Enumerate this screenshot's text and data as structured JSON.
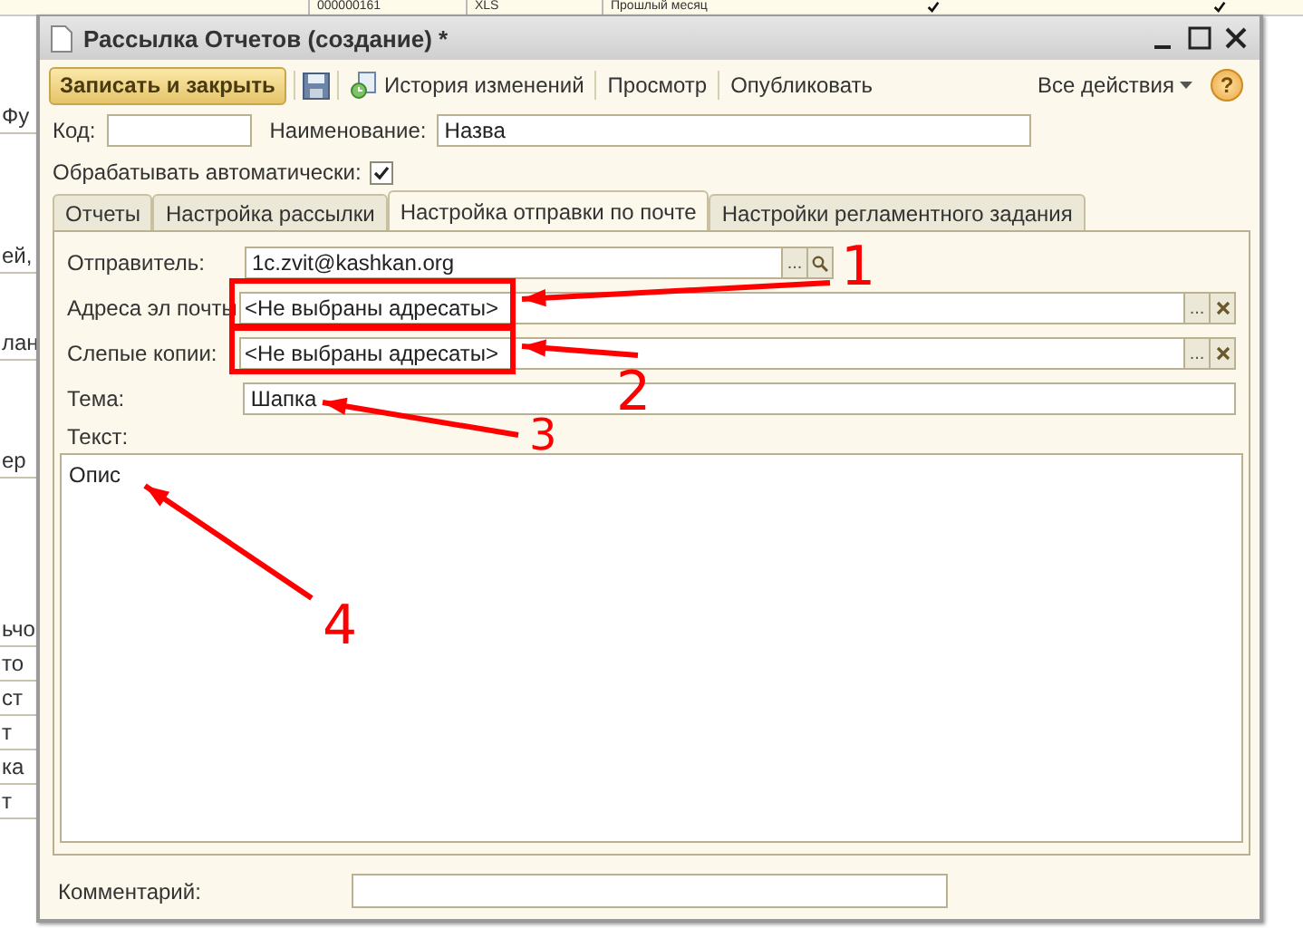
{
  "background_table": {
    "top_row": [
      "000000161",
      "XLS",
      "Прошлый месяц"
    ],
    "top_checks": [
      {
        "checked": true
      },
      {
        "checked": true
      }
    ],
    "left_fragments": [
      "Фу",
      "ей,",
      "лан",
      "ер",
      "ьчо",
      "то",
      "ст",
      "т",
      "ка",
      "т"
    ]
  },
  "window": {
    "title": "Рассылка Отчетов (создание) *"
  },
  "toolbar": {
    "primary_button": "Записать и закрыть",
    "history": "История изменений",
    "preview": "Просмотр",
    "publish": "Опубликовать",
    "all_actions": "Все действия",
    "help": "?"
  },
  "code_field": {
    "label": "Код:"
  },
  "name_field": {
    "label": "Наименование:",
    "value": "Назва"
  },
  "auto_process": {
    "label": "Обрабатывать автоматически:",
    "checked": true
  },
  "tabs": [
    {
      "label": "Отчеты",
      "selected": false
    },
    {
      "label": "Настройка рассылки",
      "selected": false
    },
    {
      "label": "Настройка отправки по почте",
      "selected": true
    },
    {
      "label": "Настройки регламентного задания",
      "selected": false
    }
  ],
  "mail_settings": {
    "sender": {
      "label": "Отправитель:",
      "value": "1c.zvit@kashkan.org",
      "choose": "..."
    },
    "recipients": {
      "label": "Адреса эл почты",
      "placeholder": "<Не выбраны адресаты>",
      "choose": "..."
    },
    "bcc": {
      "label": "Слепые копии:",
      "placeholder": "<Не выбраны адресаты>",
      "choose": "..."
    },
    "subject": {
      "label": "Тема:",
      "value": "Шапка"
    },
    "body": {
      "label": "Текст:",
      "value": "Опис"
    }
  },
  "comment": {
    "label": "Комментарий:"
  },
  "annotations": [
    {
      "label": "1"
    },
    {
      "label": "2"
    },
    {
      "label": "3"
    },
    {
      "label": "4"
    }
  ]
}
